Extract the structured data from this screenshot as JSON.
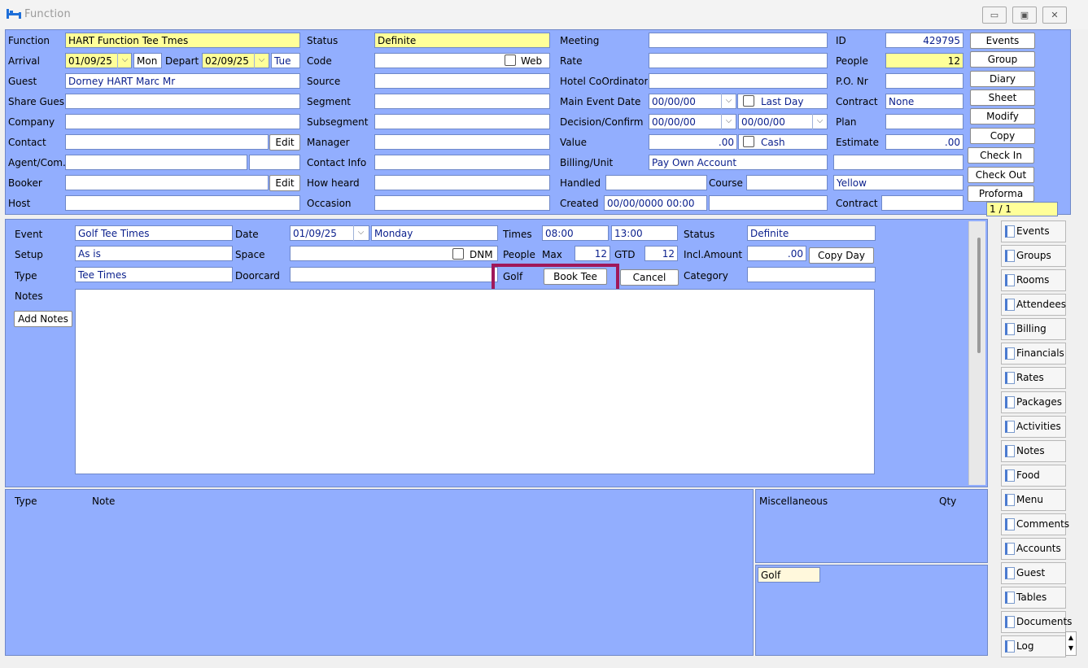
{
  "window": {
    "title": "Function",
    "btn_min": "▭",
    "btn_max": "▣",
    "btn_close": "✕"
  },
  "top": {
    "function_label": "Function",
    "function": "HART Function Tee Tmes",
    "arrival_label": "Arrival",
    "arrival": "01/09/25",
    "arrival_day": "Mon",
    "depart_label": "Depart",
    "depart": "02/09/25",
    "depart_day": "Tue",
    "guest_label": "Guest",
    "guest": "Dorney HART Marc Mr",
    "share_label": "Share Gues",
    "company_label": "Company",
    "contact_label": "Contact",
    "agent_label": "Agent/Com.",
    "booker_label": "Booker",
    "host_label": "Host",
    "edit": "Edit",
    "status_label": "Status",
    "status": "Definite",
    "code_label": "Code",
    "web": "Web",
    "source_label": "Source",
    "segment_label": "Segment",
    "subsegment_label": "Subsegment",
    "manager_label": "Manager",
    "contactinfo_label": "Contact Info",
    "howheard_label": "How heard",
    "occasion_label": "Occasion",
    "meeting_label": "Meeting",
    "rate_label": "Rate",
    "hotelcoord_label": "Hotel CoOrdinator",
    "maineventdate_label": "Main Event Date",
    "maineventdate": "00/00/00",
    "lastday": "Last Day",
    "decision_label": "Decision/Confirm",
    "decision1": "00/00/00",
    "decision2": "00/00/00",
    "value_label": "Value",
    "value": ".00",
    "cash": "Cash",
    "billing_label": "Billing/Unit",
    "billing": "Pay Own Account",
    "handled_label": "Handled",
    "course_label": "Course",
    "created_label": "Created",
    "created": "00/00/0000 00:00",
    "id_label": "ID",
    "id": "429795",
    "people_label": "People",
    "people": "12",
    "po_label": "P.O. Nr",
    "contract_label": "Contract",
    "contract": "None",
    "plan_label": "Plan",
    "estimate_label": "Estimate",
    "estimate": ".00",
    "yellow": "Yellow",
    "contract2_label": "Contract",
    "page": "1 / 1"
  },
  "buttons": [
    "Events",
    "Group",
    "Diary",
    "Sheet",
    "Modify",
    "Copy",
    "Check In",
    "Check Out",
    "Proforma"
  ],
  "event": {
    "event_label": "Event",
    "event": "Golf Tee Times",
    "setup_label": "Setup",
    "setup": "As is",
    "type_label": "Type",
    "type": "Tee Times",
    "notes_label": "Notes",
    "add_notes": "Add Notes",
    "date_label": "Date",
    "date": "01/09/25",
    "day": "Monday",
    "space_label": "Space",
    "dnm": "DNM",
    "doorcard_label": "Doorcard",
    "times_label": "Times",
    "time_from": "08:00",
    "time_to": "13:00",
    "people_label": "People",
    "max_label": "Max",
    "max": "12",
    "gtd_label": "GTD",
    "gtd": "12",
    "golf_label": "Golf",
    "book_tee": "Book Tee",
    "cancel": "Cancel",
    "status_label": "Status",
    "status": "Definite",
    "incl_label": "Incl.Amount",
    "incl": ".00",
    "copy_day": "Copy Day",
    "category_label": "Category"
  },
  "bottom": {
    "type_col": "Type",
    "note_col": "Note",
    "misc_label": "Miscellaneous",
    "qty_label": "Qty",
    "golf_item": "Golf"
  },
  "sidebar": [
    "Events",
    "Groups",
    "Rooms",
    "Attendees",
    "Billing",
    "Financials",
    "Rates",
    "Packages",
    "Activities",
    "Notes",
    "Food",
    "Menu",
    "Comments",
    "Accounts",
    "Guest",
    "Tables",
    "Documents",
    "Log"
  ],
  "colors": {
    "panel": "#92aefe",
    "highlight": "#a0185a",
    "yellow": "#ffff99"
  }
}
